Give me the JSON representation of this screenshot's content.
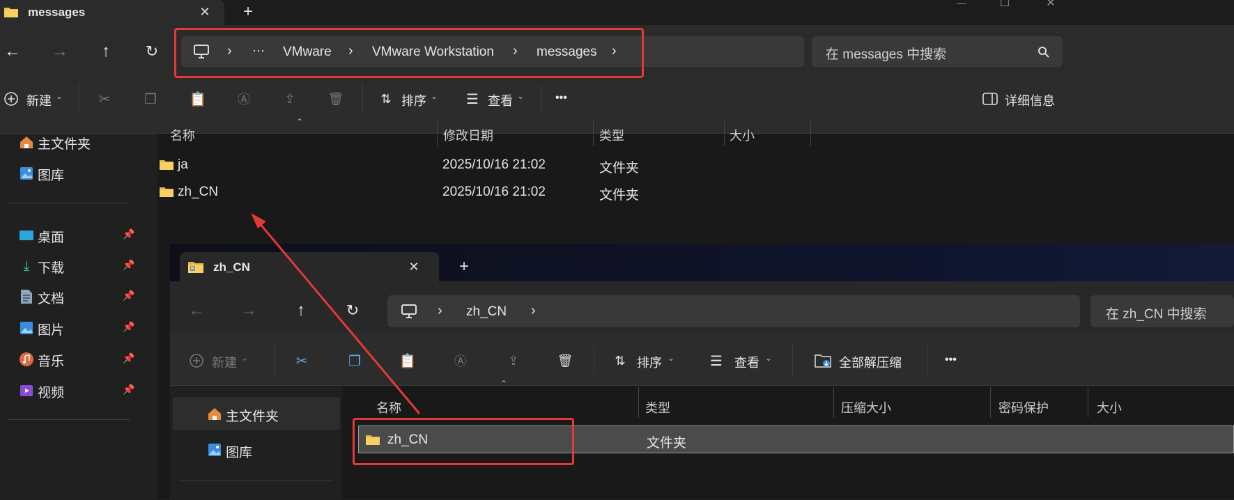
{
  "window1": {
    "tab": {
      "title": "messages"
    },
    "window_controls": {
      "minimize": "—",
      "maximize": "☐",
      "close": "✕"
    },
    "breadcrumb": [
      "···",
      "VMware",
      "VMware Workstation",
      "messages"
    ],
    "search_placeholder": "在 messages 中搜索",
    "toolbar": {
      "new": "新建",
      "sort": "排序",
      "view": "查看",
      "more": "•••",
      "details": "详细信息"
    },
    "columns": [
      "名称",
      "修改日期",
      "类型",
      "大小"
    ],
    "rows": [
      {
        "name": "ja",
        "date": "2025/10/16 21:02",
        "type": "文件夹"
      },
      {
        "name": "zh_CN",
        "date": "2025/10/16 21:02",
        "type": "文件夹"
      }
    ],
    "sidebar": {
      "top": [
        "主文件夹",
        "图库"
      ],
      "pinned": [
        "桌面",
        "下载",
        "文档",
        "图片",
        "音乐",
        "视频"
      ]
    }
  },
  "window2": {
    "tab": {
      "title": "zh_CN"
    },
    "breadcrumb": [
      "zh_CN"
    ],
    "search_placeholder": "在 zh_CN 中搜索",
    "toolbar": {
      "new": "新建",
      "sort": "排序",
      "view": "查看",
      "extract_all": "全部解压缩",
      "more": "•••"
    },
    "columns": [
      "名称",
      "类型",
      "压缩大小",
      "密码保护",
      "大小"
    ],
    "rows": [
      {
        "name": "zh_CN",
        "type": "文件夹"
      }
    ],
    "sidebar": {
      "top": [
        "主文件夹",
        "图库"
      ]
    }
  },
  "colors": {
    "annotation": "#e53935",
    "folder": "#f2c14e",
    "background": "#202020"
  }
}
